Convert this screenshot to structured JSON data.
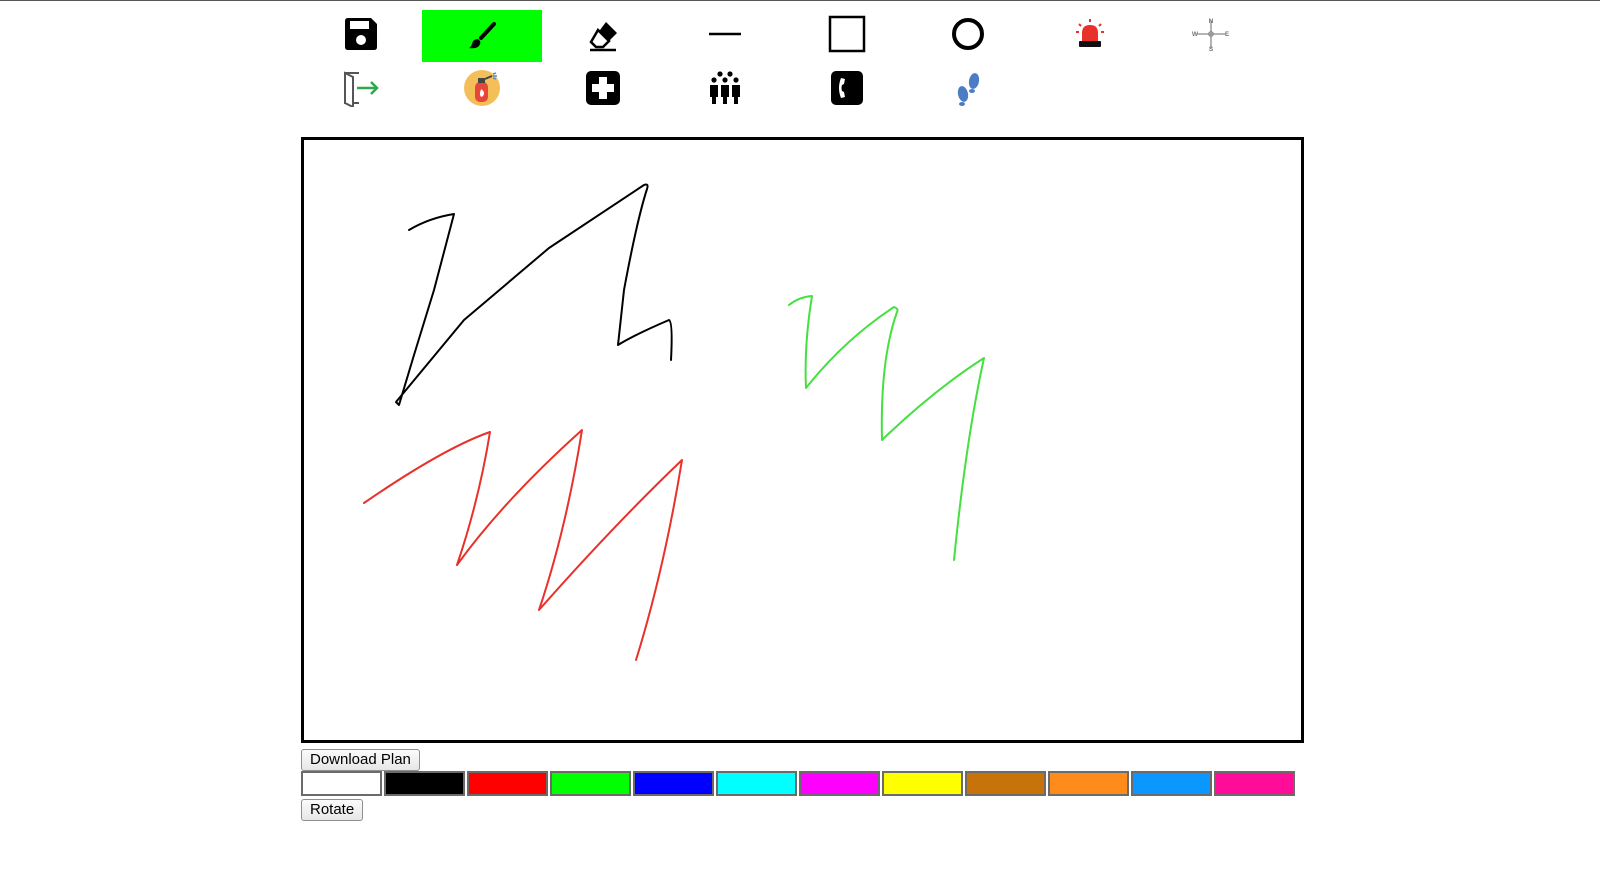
{
  "toolbar": {
    "tools": [
      {
        "name": "save",
        "icon": "floppy-disk-icon",
        "active": false
      },
      {
        "name": "brush",
        "icon": "paintbrush-icon",
        "active": true,
        "highlight": "#00ff00"
      },
      {
        "name": "eraser",
        "icon": "eraser-icon",
        "active": false
      },
      {
        "name": "line",
        "icon": "line-icon",
        "active": false
      },
      {
        "name": "rectangle",
        "icon": "square-icon",
        "active": false
      },
      {
        "name": "circle",
        "icon": "circle-icon",
        "active": false
      },
      {
        "name": "alarm",
        "icon": "siren-icon",
        "active": false
      },
      {
        "name": "compass",
        "icon": "compass-rose-icon",
        "active": false,
        "letters": [
          "N",
          "W",
          "E",
          "S"
        ]
      },
      {
        "name": "exit",
        "icon": "exit-door-icon",
        "active": false
      },
      {
        "name": "fire-extinguisher",
        "icon": "fire-extinguisher-icon",
        "active": false
      },
      {
        "name": "first-aid",
        "icon": "first-aid-cross-icon",
        "active": false
      },
      {
        "name": "assembly-point",
        "icon": "people-group-icon",
        "active": false
      },
      {
        "name": "emergency-phone",
        "icon": "phone-icon",
        "active": false
      },
      {
        "name": "evacuation-route",
        "icon": "footprints-icon",
        "active": false
      }
    ]
  },
  "canvas": {
    "strokes": [
      {
        "color": "#000000",
        "label": "black-stroke"
      },
      {
        "color": "#44e040",
        "label": "green-stroke"
      },
      {
        "color": "#e8312a",
        "label": "red-stroke"
      }
    ]
  },
  "buttons": {
    "download_label": "Download Plan",
    "rotate_label": "Rotate"
  },
  "palette": {
    "colors": [
      {
        "name": "white",
        "hex": "#ffffff"
      },
      {
        "name": "black",
        "hex": "#000000"
      },
      {
        "name": "red",
        "hex": "#ff0000"
      },
      {
        "name": "green",
        "hex": "#00ff00"
      },
      {
        "name": "blue",
        "hex": "#0000ff"
      },
      {
        "name": "cyan",
        "hex": "#00ffff"
      },
      {
        "name": "magenta",
        "hex": "#ff00ff"
      },
      {
        "name": "yellow",
        "hex": "#ffff00"
      },
      {
        "name": "brown",
        "hex": "#c8720a"
      },
      {
        "name": "orange",
        "hex": "#ff8c1a"
      },
      {
        "name": "sky-blue",
        "hex": "#0a98ff"
      },
      {
        "name": "pink",
        "hex": "#ff0c98"
      }
    ]
  }
}
